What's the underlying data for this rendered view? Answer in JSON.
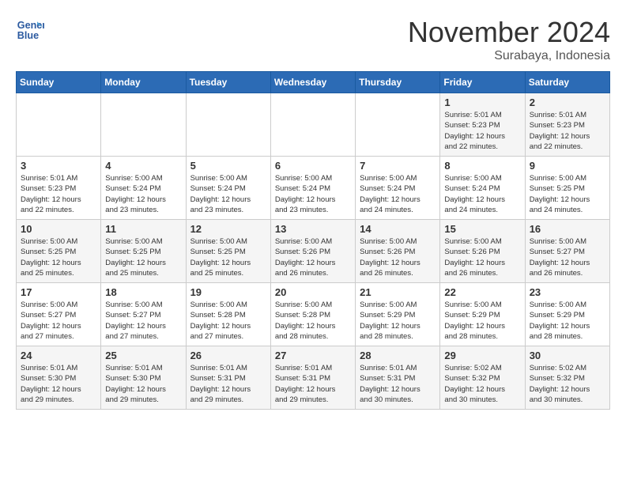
{
  "logo": {
    "line1": "General",
    "line2": "Blue"
  },
  "title": "November 2024",
  "location": "Surabaya, Indonesia",
  "weekdays": [
    "Sunday",
    "Monday",
    "Tuesday",
    "Wednesday",
    "Thursday",
    "Friday",
    "Saturday"
  ],
  "weeks": [
    [
      {
        "day": "",
        "info": ""
      },
      {
        "day": "",
        "info": ""
      },
      {
        "day": "",
        "info": ""
      },
      {
        "day": "",
        "info": ""
      },
      {
        "day": "",
        "info": ""
      },
      {
        "day": "1",
        "info": "Sunrise: 5:01 AM\nSunset: 5:23 PM\nDaylight: 12 hours\nand 22 minutes."
      },
      {
        "day": "2",
        "info": "Sunrise: 5:01 AM\nSunset: 5:23 PM\nDaylight: 12 hours\nand 22 minutes."
      }
    ],
    [
      {
        "day": "3",
        "info": "Sunrise: 5:01 AM\nSunset: 5:23 PM\nDaylight: 12 hours\nand 22 minutes."
      },
      {
        "day": "4",
        "info": "Sunrise: 5:00 AM\nSunset: 5:24 PM\nDaylight: 12 hours\nand 23 minutes."
      },
      {
        "day": "5",
        "info": "Sunrise: 5:00 AM\nSunset: 5:24 PM\nDaylight: 12 hours\nand 23 minutes."
      },
      {
        "day": "6",
        "info": "Sunrise: 5:00 AM\nSunset: 5:24 PM\nDaylight: 12 hours\nand 23 minutes."
      },
      {
        "day": "7",
        "info": "Sunrise: 5:00 AM\nSunset: 5:24 PM\nDaylight: 12 hours\nand 24 minutes."
      },
      {
        "day": "8",
        "info": "Sunrise: 5:00 AM\nSunset: 5:24 PM\nDaylight: 12 hours\nand 24 minutes."
      },
      {
        "day": "9",
        "info": "Sunrise: 5:00 AM\nSunset: 5:25 PM\nDaylight: 12 hours\nand 24 minutes."
      }
    ],
    [
      {
        "day": "10",
        "info": "Sunrise: 5:00 AM\nSunset: 5:25 PM\nDaylight: 12 hours\nand 25 minutes."
      },
      {
        "day": "11",
        "info": "Sunrise: 5:00 AM\nSunset: 5:25 PM\nDaylight: 12 hours\nand 25 minutes."
      },
      {
        "day": "12",
        "info": "Sunrise: 5:00 AM\nSunset: 5:25 PM\nDaylight: 12 hours\nand 25 minutes."
      },
      {
        "day": "13",
        "info": "Sunrise: 5:00 AM\nSunset: 5:26 PM\nDaylight: 12 hours\nand 26 minutes."
      },
      {
        "day": "14",
        "info": "Sunrise: 5:00 AM\nSunset: 5:26 PM\nDaylight: 12 hours\nand 26 minutes."
      },
      {
        "day": "15",
        "info": "Sunrise: 5:00 AM\nSunset: 5:26 PM\nDaylight: 12 hours\nand 26 minutes."
      },
      {
        "day": "16",
        "info": "Sunrise: 5:00 AM\nSunset: 5:27 PM\nDaylight: 12 hours\nand 26 minutes."
      }
    ],
    [
      {
        "day": "17",
        "info": "Sunrise: 5:00 AM\nSunset: 5:27 PM\nDaylight: 12 hours\nand 27 minutes."
      },
      {
        "day": "18",
        "info": "Sunrise: 5:00 AM\nSunset: 5:27 PM\nDaylight: 12 hours\nand 27 minutes."
      },
      {
        "day": "19",
        "info": "Sunrise: 5:00 AM\nSunset: 5:28 PM\nDaylight: 12 hours\nand 27 minutes."
      },
      {
        "day": "20",
        "info": "Sunrise: 5:00 AM\nSunset: 5:28 PM\nDaylight: 12 hours\nand 28 minutes."
      },
      {
        "day": "21",
        "info": "Sunrise: 5:00 AM\nSunset: 5:29 PM\nDaylight: 12 hours\nand 28 minutes."
      },
      {
        "day": "22",
        "info": "Sunrise: 5:00 AM\nSunset: 5:29 PM\nDaylight: 12 hours\nand 28 minutes."
      },
      {
        "day": "23",
        "info": "Sunrise: 5:00 AM\nSunset: 5:29 PM\nDaylight: 12 hours\nand 28 minutes."
      }
    ],
    [
      {
        "day": "24",
        "info": "Sunrise: 5:01 AM\nSunset: 5:30 PM\nDaylight: 12 hours\nand 29 minutes."
      },
      {
        "day": "25",
        "info": "Sunrise: 5:01 AM\nSunset: 5:30 PM\nDaylight: 12 hours\nand 29 minutes."
      },
      {
        "day": "26",
        "info": "Sunrise: 5:01 AM\nSunset: 5:31 PM\nDaylight: 12 hours\nand 29 minutes."
      },
      {
        "day": "27",
        "info": "Sunrise: 5:01 AM\nSunset: 5:31 PM\nDaylight: 12 hours\nand 29 minutes."
      },
      {
        "day": "28",
        "info": "Sunrise: 5:01 AM\nSunset: 5:31 PM\nDaylight: 12 hours\nand 30 minutes."
      },
      {
        "day": "29",
        "info": "Sunrise: 5:02 AM\nSunset: 5:32 PM\nDaylight: 12 hours\nand 30 minutes."
      },
      {
        "day": "30",
        "info": "Sunrise: 5:02 AM\nSunset: 5:32 PM\nDaylight: 12 hours\nand 30 minutes."
      }
    ]
  ]
}
